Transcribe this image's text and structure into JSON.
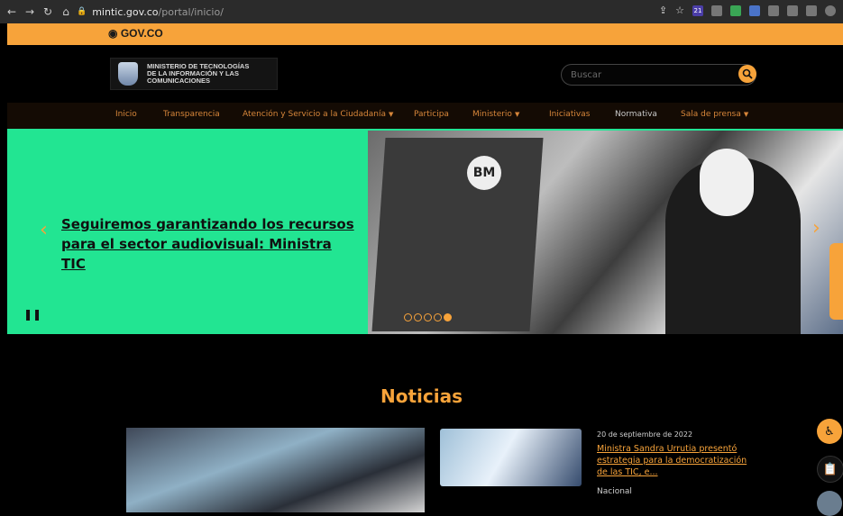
{
  "browser": {
    "url_host": "mintic.gov.co",
    "url_path": "/portal/inicio/",
    "ext_badge": "21"
  },
  "govbar": {
    "logo": "GOV.CO"
  },
  "header": {
    "logo_text": [
      "MINISTERIO DE TECNOLOGÍAS",
      "DE LA INFORMACIÓN Y LAS",
      "COMUNICACIONES"
    ]
  },
  "search": {
    "placeholder": "Buscar"
  },
  "nav": {
    "items": [
      "Inicio",
      "Transparencia",
      "Atención y Servicio a la Ciudadanía",
      "Participa",
      "Ministerio",
      "Iniciativas",
      "Normativa",
      "Sala de prensa"
    ]
  },
  "hero": {
    "title": "Seguiremos garantizando los recursos para el sector audiovisual: Ministra TIC",
    "flag_logo": "BM",
    "slides": 5,
    "active_slide": 5
  },
  "news": {
    "section_title": "Noticias",
    "items": [
      {
        "date": "20 de septiembre de 2022",
        "title": "Ministra Sandra Urrutia presentó estrategia para la democratización de las TIC, e...",
        "category": "Nacional"
      }
    ]
  },
  "colors": {
    "accent": "#f7a33a",
    "hero_bg": "#22e592",
    "background": "#000000"
  }
}
